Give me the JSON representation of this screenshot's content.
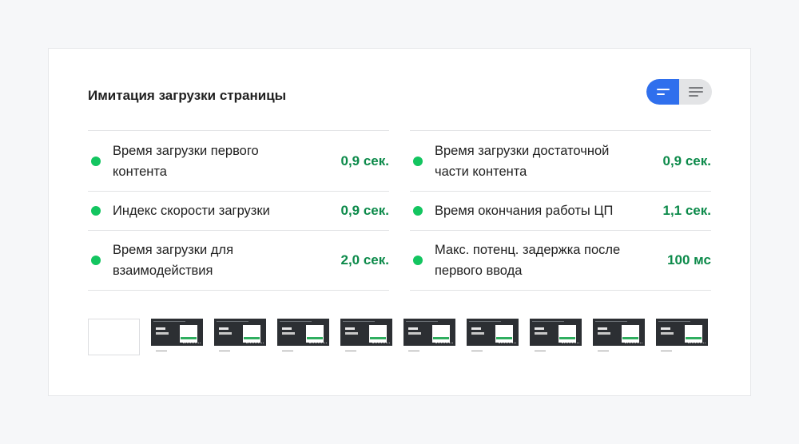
{
  "section": {
    "title": "Имитация загрузки страницы"
  },
  "view_toggle": {
    "active": "summary-view",
    "options": [
      "summary-view",
      "list-view"
    ]
  },
  "metrics": {
    "left": [
      {
        "label": "Время загрузки первого контента",
        "value": "0,9 сек."
      },
      {
        "label": "Индекс скорости загрузки",
        "value": "0,9 сек."
      },
      {
        "label": "Время загрузки для взаимодействия",
        "value": "2,0 сек."
      }
    ],
    "right": [
      {
        "label": "Время загрузки достаточной части контента",
        "value": "0,9 сек."
      },
      {
        "label": "Время окончания работы ЦП",
        "value": "1,1 сек."
      },
      {
        "label": "Макс. потенц. задержка после первого ввода",
        "value": "100 мс"
      }
    ]
  },
  "colors": {
    "pass_dot": "#13c560",
    "pass_value": "#0c8a4a",
    "toggle_active": "#2f6fed"
  },
  "filmstrip": {
    "frames": [
      "blank",
      "loaded",
      "loaded",
      "loaded",
      "loaded",
      "loaded",
      "loaded",
      "loaded",
      "loaded",
      "loaded"
    ]
  }
}
